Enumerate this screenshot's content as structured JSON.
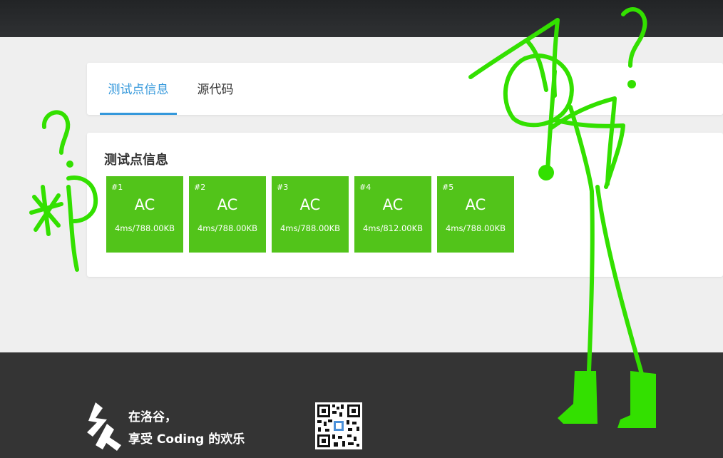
{
  "tabs": [
    {
      "label": "测试点信息",
      "active": true
    },
    {
      "label": "源代码",
      "active": false
    }
  ],
  "testcases": {
    "title": "测试点信息",
    "items": [
      {
        "id": "#1",
        "status": "AC",
        "stat": "4ms/788.00KB"
      },
      {
        "id": "#2",
        "status": "AC",
        "stat": "4ms/788.00KB"
      },
      {
        "id": "#3",
        "status": "AC",
        "stat": "4ms/788.00KB"
      },
      {
        "id": "#4",
        "status": "AC",
        "stat": "4ms/812.00KB"
      },
      {
        "id": "#5",
        "status": "AC",
        "stat": "4ms/788.00KB"
      }
    ]
  },
  "footer": {
    "slogan_line1": "在洛谷，",
    "slogan_line2": "享受 Coding 的欢乐",
    "logo_icon": "luogu-logo-icon",
    "qr_icon": "qr-code-icon"
  },
  "colors": {
    "accent": "#3498db",
    "ac_green": "#52c41a",
    "doodle_green": "#33e000",
    "footer_bg": "#343434"
  }
}
